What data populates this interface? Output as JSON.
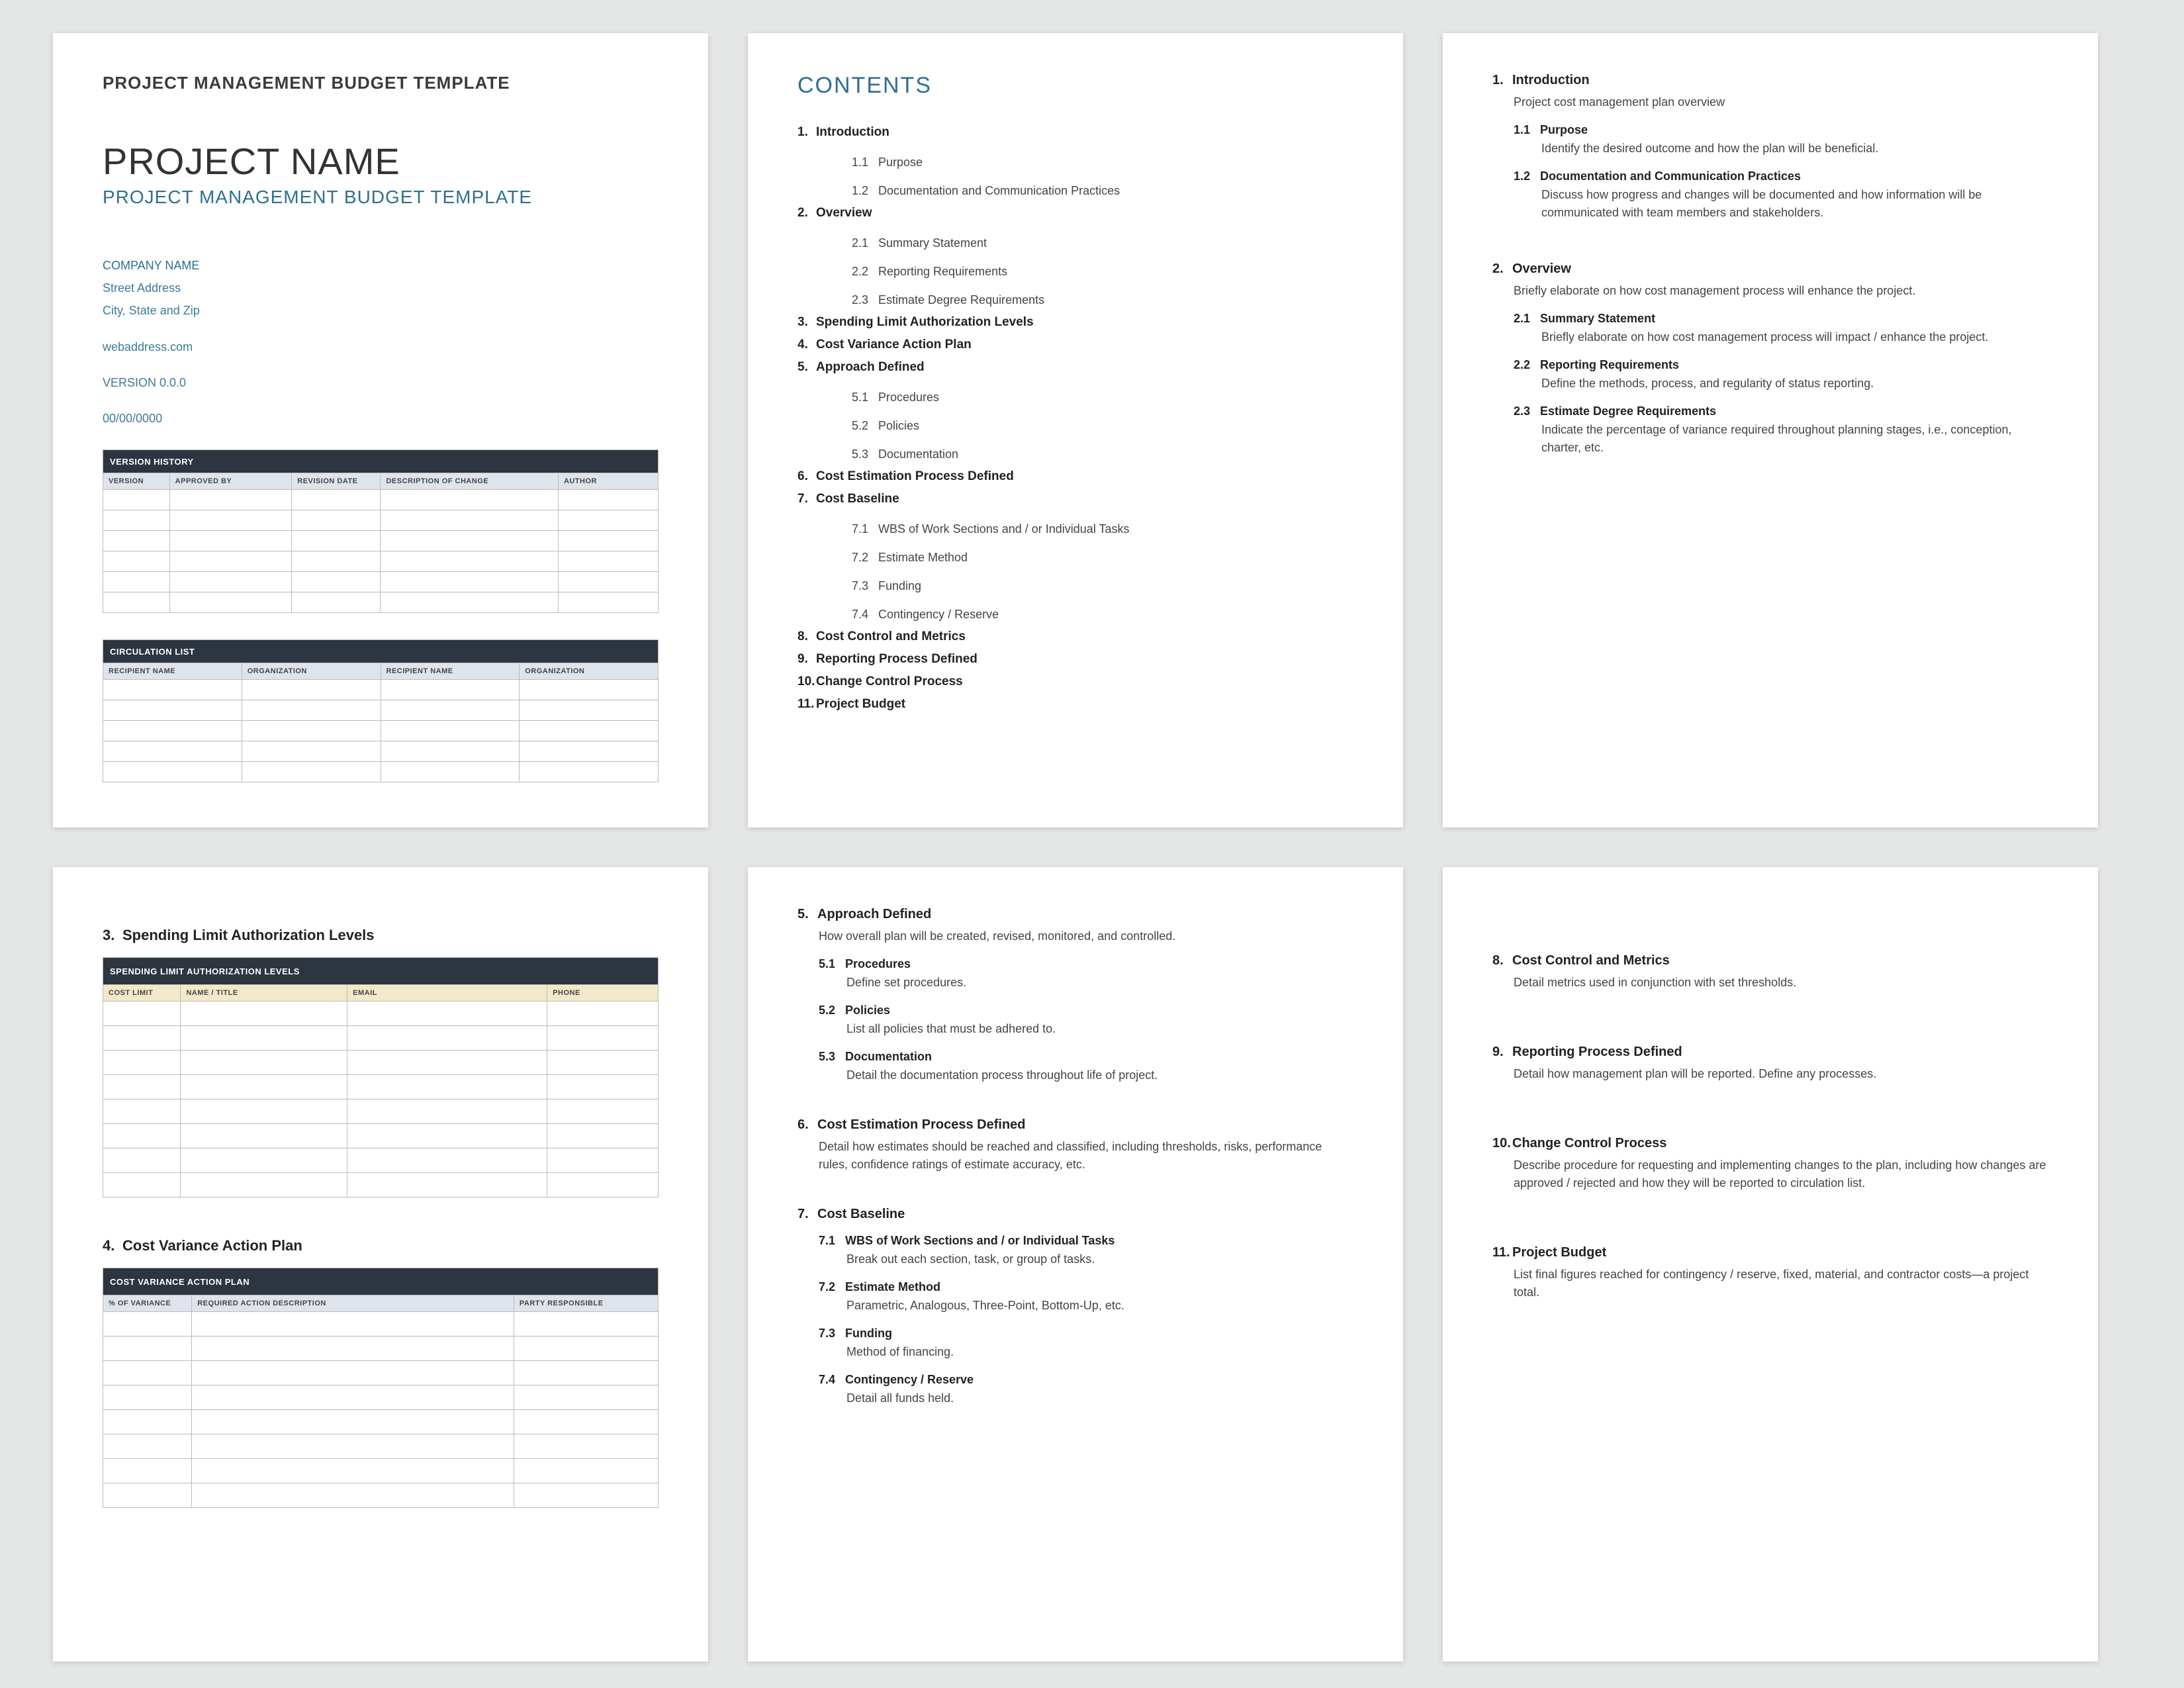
{
  "p1": {
    "header": "PROJECT MANAGEMENT BUDGET TEMPLATE",
    "title": "PROJECT NAME",
    "subtitle": "PROJECT MANAGEMENT BUDGET TEMPLATE",
    "company": "COMPANY NAME",
    "street": "Street Address",
    "city": "City, State and Zip",
    "web": "webaddress.com",
    "version": "VERSION 0.0.0",
    "date": "00/00/0000",
    "vh": {
      "title": "VERSION HISTORY",
      "cols": [
        "VERSION",
        "APPROVED BY",
        "REVISION DATE",
        "DESCRIPTION OF CHANGE",
        "AUTHOR"
      ]
    },
    "cl": {
      "title": "CIRCULATION LIST",
      "cols": [
        "RECIPIENT NAME",
        "ORGANIZATION",
        "RECIPIENT NAME",
        "ORGANIZATION"
      ]
    }
  },
  "toc": {
    "title": "CONTENTS",
    "items": [
      {
        "n": "1.",
        "t": "Introduction",
        "sub": [
          {
            "n": "1.1",
            "t": "Purpose"
          },
          {
            "n": "1.2",
            "t": "Documentation and Communication Practices"
          }
        ]
      },
      {
        "n": "2.",
        "t": "Overview",
        "sub": [
          {
            "n": "2.1",
            "t": "Summary Statement"
          },
          {
            "n": "2.2",
            "t": "Reporting Requirements"
          },
          {
            "n": "2.3",
            "t": "Estimate Degree Requirements"
          }
        ]
      },
      {
        "n": "3.",
        "t": "Spending Limit Authorization Levels"
      },
      {
        "n": "4.",
        "t": "Cost Variance Action Plan"
      },
      {
        "n": "5.",
        "t": "Approach Defined",
        "sub": [
          {
            "n": "5.1",
            "t": "Procedures"
          },
          {
            "n": "5.2",
            "t": "Policies"
          },
          {
            "n": "5.3",
            "t": "Documentation"
          }
        ]
      },
      {
        "n": "6.",
        "t": "Cost Estimation Process Defined"
      },
      {
        "n": "7.",
        "t": "Cost Baseline",
        "sub": [
          {
            "n": "7.1",
            "t": "WBS of Work Sections and / or Individual Tasks"
          },
          {
            "n": "7.2",
            "t": "Estimate Method"
          },
          {
            "n": "7.3",
            "t": "Funding"
          },
          {
            "n": "7.4",
            "t": "Contingency / Reserve"
          }
        ]
      },
      {
        "n": "8.",
        "t": "Cost Control and Metrics"
      },
      {
        "n": "9.",
        "t": "Reporting Process Defined"
      },
      {
        "n": "10.",
        "t": "Change Control Process"
      },
      {
        "n": "11.",
        "t": "Project Budget"
      }
    ]
  },
  "p3": {
    "s1": {
      "n": "1.",
      "t": "Introduction",
      "body": "Project cost management plan overview",
      "sub": [
        {
          "n": "1.1",
          "t": "Purpose",
          "body": "Identify the desired outcome and how the plan will be beneficial."
        },
        {
          "n": "1.2",
          "t": "Documentation and Communication Practices",
          "body": "Discuss how progress and changes will be documented and how information will be communicated with team members and stakeholders."
        }
      ]
    },
    "s2": {
      "n": "2.",
      "t": "Overview",
      "body": "Briefly elaborate on how cost management process will enhance the project.",
      "sub": [
        {
          "n": "2.1",
          "t": "Summary Statement",
          "body": "Briefly elaborate on how cost management process will impact / enhance the project."
        },
        {
          "n": "2.2",
          "t": "Reporting Requirements",
          "body": "Define the methods, process, and regularity of status reporting."
        },
        {
          "n": "2.3",
          "t": "Estimate Degree Requirements",
          "body": "Indicate the percentage of variance required throughout planning stages, i.e., conception, charter, etc."
        }
      ]
    }
  },
  "p4": {
    "s3": {
      "n": "3.",
      "t": "Spending Limit Authorization Levels",
      "tbl": {
        "title": "SPENDING LIMIT AUTHORIZATION LEVELS",
        "cols": [
          "COST LIMIT",
          "NAME / TITLE",
          "EMAIL",
          "PHONE"
        ]
      }
    },
    "s4": {
      "n": "4.",
      "t": "Cost Variance Action Plan",
      "tbl": {
        "title": "COST VARIANCE ACTION PLAN",
        "cols": [
          "% OF VARIANCE",
          "REQUIRED ACTION DESCRIPTION",
          "PARTY RESPONSIBLE"
        ]
      }
    }
  },
  "p5": {
    "s5": {
      "n": "5.",
      "t": "Approach Defined",
      "body": "How overall plan will be created, revised, monitored, and controlled.",
      "sub": [
        {
          "n": "5.1",
          "t": "Procedures",
          "body": "Define set procedures."
        },
        {
          "n": "5.2",
          "t": "Policies",
          "body": "List all policies that must be adhered to."
        },
        {
          "n": "5.3",
          "t": "Documentation",
          "body": "Detail the documentation process throughout life of project."
        }
      ]
    },
    "s6": {
      "n": "6.",
      "t": "Cost Estimation Process Defined",
      "body": "Detail how estimates should be reached and classified, including thresholds, risks, performance rules, confidence ratings of estimate accuracy, etc."
    },
    "s7": {
      "n": "7.",
      "t": "Cost Baseline",
      "sub": [
        {
          "n": "7.1",
          "t": "WBS of Work Sections and / or Individual Tasks",
          "body": "Break out each section, task, or group of tasks."
        },
        {
          "n": "7.2",
          "t": "Estimate Method",
          "body": "Parametric, Analogous, Three-Point, Bottom-Up, etc."
        },
        {
          "n": "7.3",
          "t": "Funding",
          "body": "Method of financing."
        },
        {
          "n": "7.4",
          "t": "Contingency / Reserve",
          "body": "Detail all funds held."
        }
      ]
    }
  },
  "p6": {
    "s8": {
      "n": "8.",
      "t": "Cost Control and Metrics",
      "body": "Detail metrics used in conjunction with set thresholds."
    },
    "s9": {
      "n": "9.",
      "t": "Reporting Process Defined",
      "body": "Detail how management plan will be reported. Define any processes."
    },
    "s10": {
      "n": "10.",
      "t": "Change Control Process",
      "body": "Describe procedure for requesting and implementing changes to the plan, including how changes are approved / rejected and how they will be reported to circulation list."
    },
    "s11": {
      "n": "11.",
      "t": "Project Budget",
      "body": "List final figures reached for contingency / reserve, fixed, material, and contractor costs—a project total."
    }
  }
}
